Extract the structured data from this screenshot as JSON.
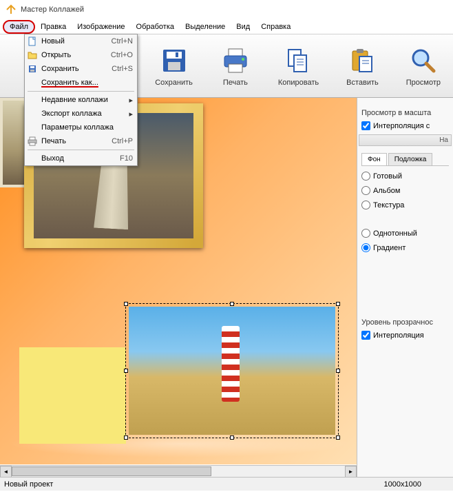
{
  "app": {
    "title": "Мастер Коллажей"
  },
  "menubar": [
    "Файл",
    "Правка",
    "Изображение",
    "Обработка",
    "Выделение",
    "Вид",
    "Справка"
  ],
  "file_menu": {
    "new": "Новый",
    "new_sc": "Ctrl+N",
    "open": "Открыть",
    "open_sc": "Ctrl+O",
    "save": "Сохранить",
    "save_sc": "Ctrl+S",
    "save_as": "Сохранить как...",
    "recent": "Недавние коллажи",
    "export": "Экспорт коллажа",
    "params": "Параметры коллажа",
    "print": "Печать",
    "print_sc": "Ctrl+P",
    "exit": "Выход",
    "exit_sc": "F10"
  },
  "toolbar": {
    "save": "Сохранить",
    "print": "Печать",
    "copy": "Копировать",
    "paste": "Вставить",
    "preview": "Просмотр"
  },
  "right": {
    "preview_label": "Просмотр в масшта",
    "interp1": "Интерполяция с",
    "section_head1": "На",
    "tab_bg": "Фон",
    "tab_under": "Подложка",
    "r_ready": "Готовый",
    "r_album": "Альбом",
    "r_texture": "Текстура",
    "r_solid": "Однотонный",
    "r_gradient": "Градиент",
    "opacity_label": "Уровень прозрачнос",
    "interp2": "Интерполяция"
  },
  "status": {
    "project": "Новый проект",
    "dims": "1000x1000"
  }
}
